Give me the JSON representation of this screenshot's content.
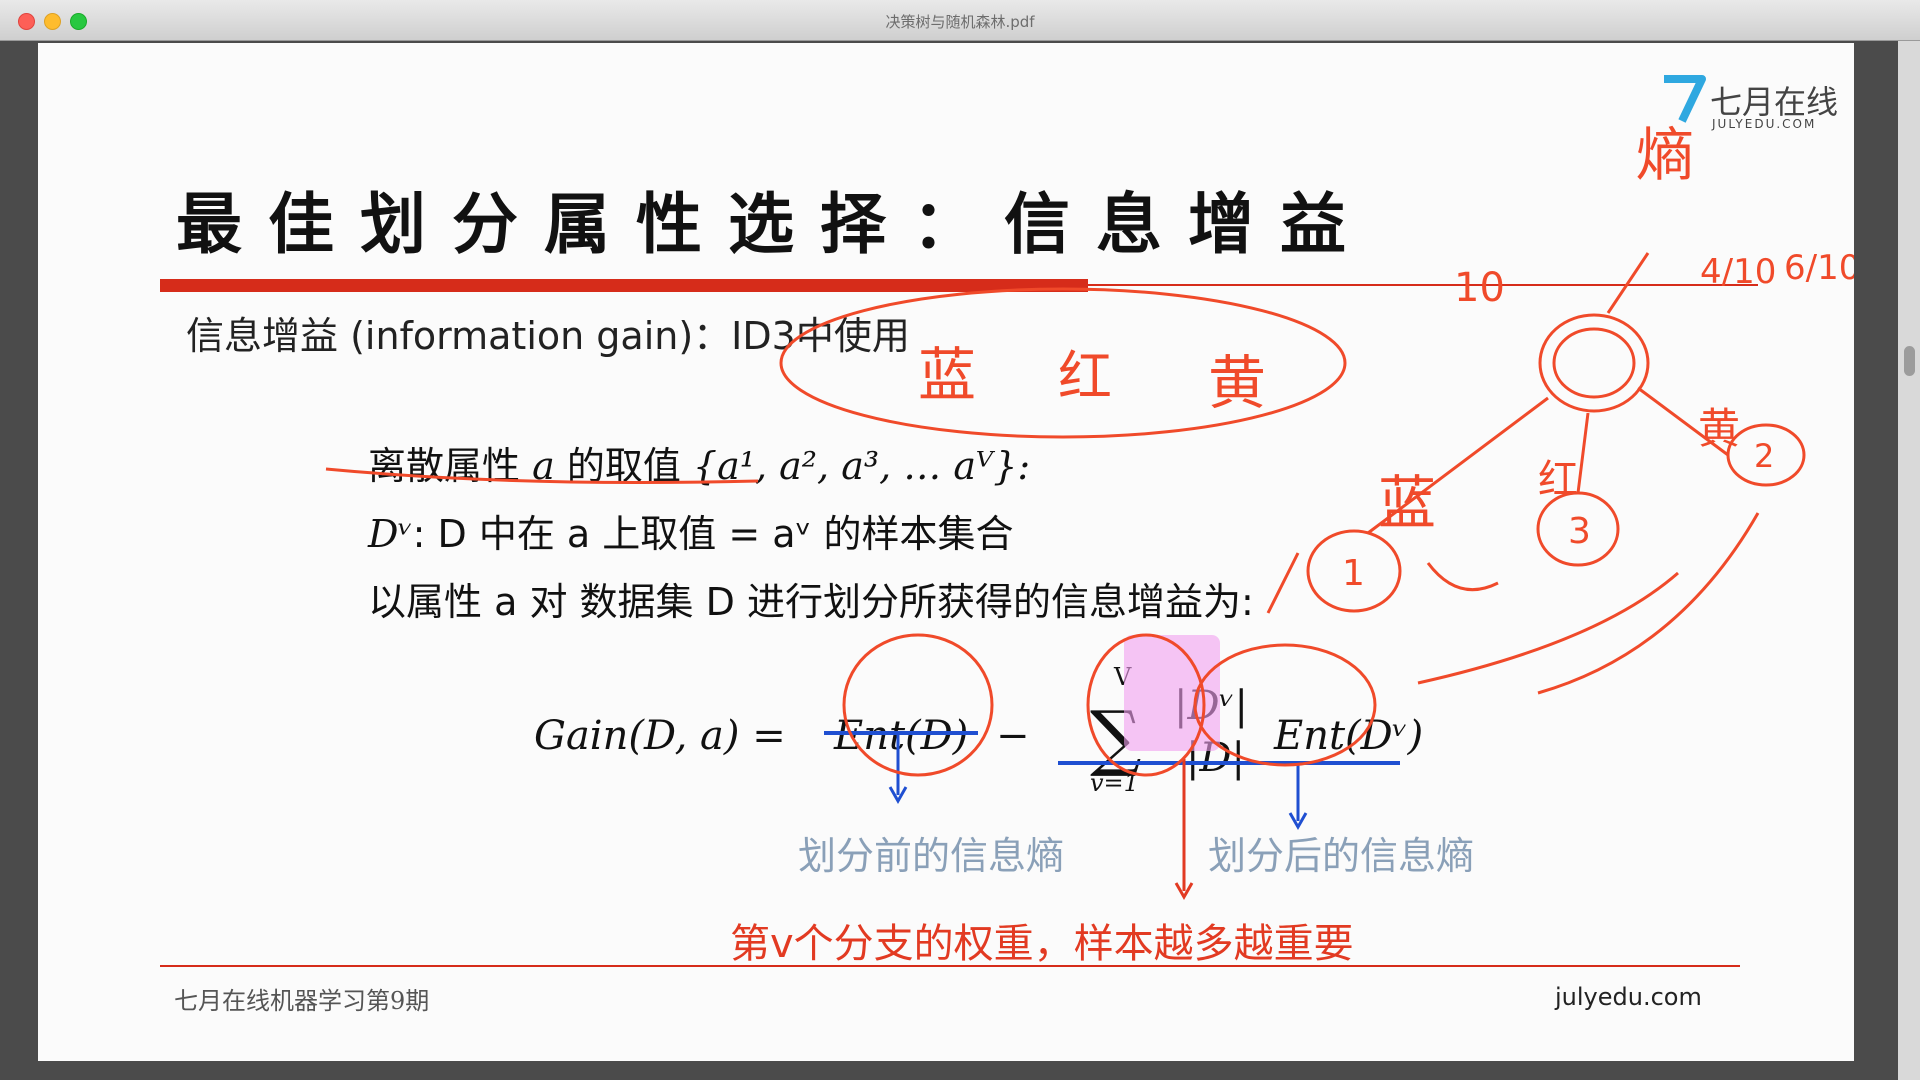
{
  "window": {
    "title": "决策树与随机森林.pdf"
  },
  "slide": {
    "logo": {
      "cn": "七月在线",
      "en": "JULYEDU.COM"
    },
    "title": "最佳划分属性选择：信息增益",
    "subtitle": "信息增益 (information gain)：ID3中使用",
    "lines": {
      "l1_prefix": "离散属性 ",
      "l1_var": "a",
      "l1_mid": " 的取值 ",
      "l1_set": "{a¹, a², a³, … aⱽ}:",
      "l2_var": "Dᵛ",
      "l2_text": ": D 中在 a 上取值 = aᵛ 的样本集合",
      "l3_text": "以属性 a 对 数据集 D 进行划分所获得的信息增益为:"
    },
    "formula": {
      "lhs": "Gain(D, a) =",
      "ent": "Ent(D)",
      "minus": "−",
      "sum_top": "V",
      "sum_bottom": "v=1",
      "frac_num": "|Dᵛ|",
      "frac_den": "|D|",
      "ent_v": "Ent(Dᵛ)"
    },
    "captions": {
      "before": "划分前的信息熵",
      "after": "划分后的信息熵",
      "weight": "第v个分支的权重，样本越多越重要"
    },
    "footer": {
      "left": "七月在线机器学习第9期",
      "right": "julyedu.com"
    },
    "annotations": {
      "entropy": "熵",
      "frac_a": "4/10",
      "frac_b": "6/10",
      "ten": "10",
      "blue": "蓝",
      "red": "红",
      "yellow": "黄",
      "n1": "1",
      "n2": "2",
      "n3": "3"
    }
  },
  "colors": {
    "accent_red": "#d62c1a",
    "ink": "#f04a2a",
    "underline_blue": "#1f4fd1",
    "highlight_pink": "#f2a0f0"
  }
}
